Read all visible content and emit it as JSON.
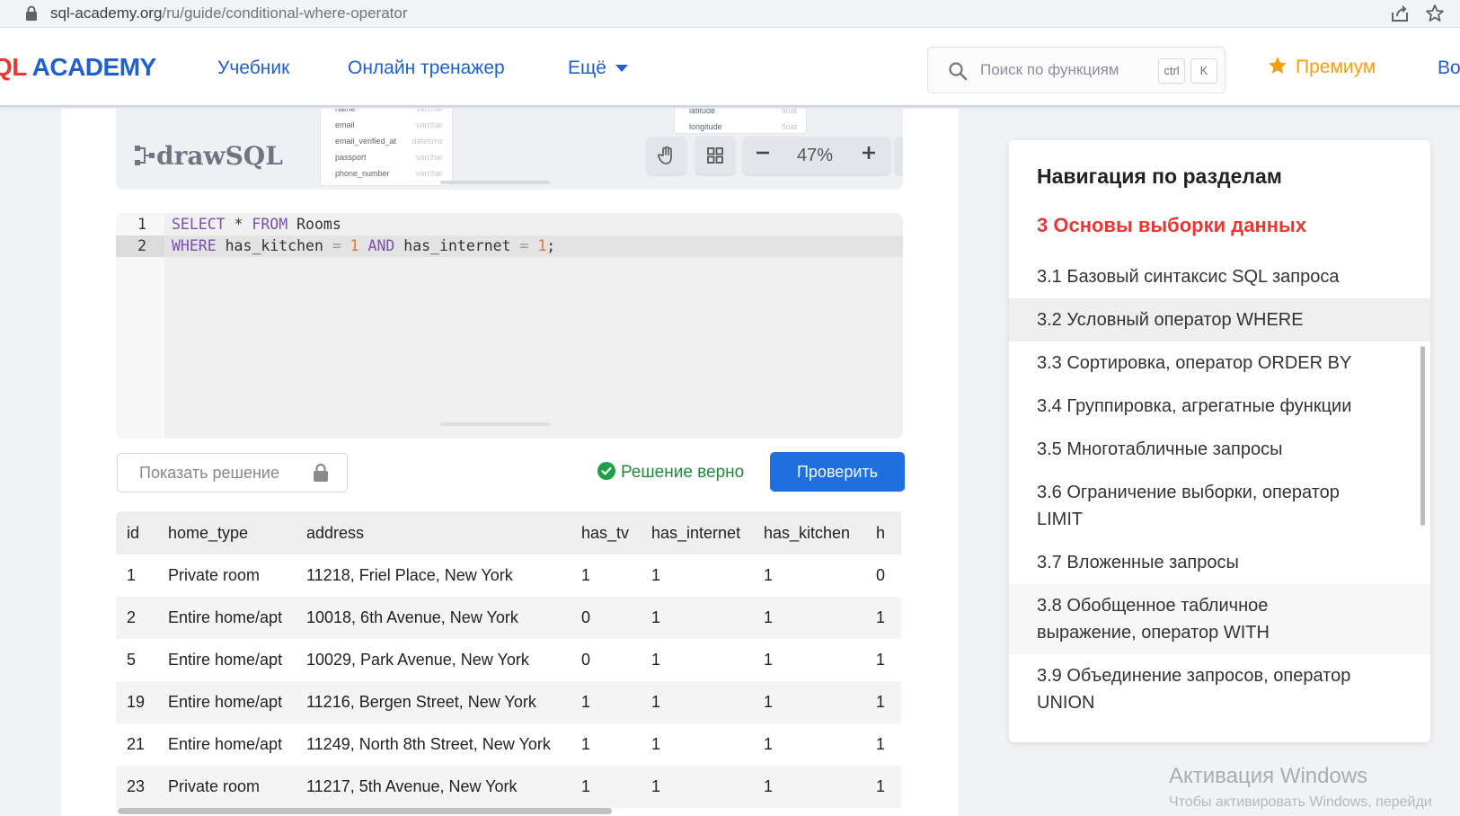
{
  "browser": {
    "url_host": "sql-academy.org",
    "url_path": "/ru/guide/conditional-where-operator"
  },
  "header": {
    "logo_red": "QL",
    "logo_blue": "ACADEMY",
    "nav": [
      "Учебник",
      "Онлайн тренажер"
    ],
    "more_label": "Ещё",
    "search_placeholder": "Поиск по функциям",
    "kbd_ctrl": "ctrl",
    "kbd_key": "K",
    "premium_label": "Премиум",
    "login_label": "Во"
  },
  "drawsql": {
    "logo_bold": "drawSQL",
    "table_left": [
      {
        "name": "name",
        "type": "varchar"
      },
      {
        "name": "email",
        "type": "varchar"
      },
      {
        "name": "email_verified_at",
        "type": "datetime"
      },
      {
        "name": "passport",
        "type": "varchar"
      },
      {
        "name": "phone_number",
        "type": "varchar"
      }
    ],
    "table_right": [
      {
        "name": "latitude",
        "type": "float"
      },
      {
        "name": "longitude",
        "type": "float"
      }
    ],
    "zoom": "47%"
  },
  "editor": {
    "line_numbers": [
      "1",
      "2"
    ],
    "line1": {
      "kw1": "SELECT",
      "star": " * ",
      "kw2": "FROM",
      "rest": " Rooms"
    },
    "line2": {
      "kw1": "WHERE",
      "col1": " has_kitchen ",
      "eq1": "=",
      "n1": " 1",
      "kw2": " AND",
      "col2": " has_internet ",
      "eq2": "=",
      "n2": " 1",
      "end": ";"
    }
  },
  "actions": {
    "show_solution": "Показать решение",
    "success_msg": "Решение верно",
    "check_btn": "Проверить"
  },
  "result": {
    "columns": [
      "id",
      "home_type",
      "address",
      "has_tv",
      "has_internet",
      "has_kitchen",
      "h"
    ],
    "rows": [
      [
        "1",
        "Private room",
        "11218, Friel Place, New York",
        "1",
        "1",
        "1",
        "0"
      ],
      [
        "2",
        "Entire home/apt",
        "10018, 6th Avenue, New York",
        "0",
        "1",
        "1",
        "1"
      ],
      [
        "5",
        "Entire home/apt",
        "10029, Park Avenue, New York",
        "0",
        "1",
        "1",
        "1"
      ],
      [
        "19",
        "Entire home/apt",
        "11216, Bergen Street, New York",
        "1",
        "1",
        "1",
        "1"
      ],
      [
        "21",
        "Entire home/apt",
        "11249, North 8th Street, New York",
        "1",
        "1",
        "1",
        "1"
      ],
      [
        "23",
        "Private room",
        "11217, 5th Avenue, New York",
        "1",
        "1",
        "1",
        "1"
      ]
    ]
  },
  "sidebar": {
    "title": "Навигация по разделам",
    "section": "3 Основы выборки данных",
    "items": [
      {
        "line1": "3.1 Базовый синтаксис SQL запроса",
        "line2": ""
      },
      {
        "line1": "3.2 Условный оператор WHERE",
        "line2": ""
      },
      {
        "line1": "3.3 Сортировка, оператор ORDER BY",
        "line2": ""
      },
      {
        "line1": "3.4 Группировка, агрегатные функции",
        "line2": ""
      },
      {
        "line1": "3.5 Многотабличные запросы",
        "line2": ""
      },
      {
        "line1": "3.6 Ограничение выборки, оператор",
        "line2": "LIMIT"
      },
      {
        "line1": "3.7 Вложенные запросы",
        "line2": ""
      },
      {
        "line1": "3.8 Обобщенное табличное",
        "line2": "выражение, оператор WITH"
      },
      {
        "line1": "3.9 Объединение запросов, оператор",
        "line2": "UNION"
      }
    ]
  },
  "watermark": {
    "title": "Активация Windows",
    "subtitle": "Чтобы активировать Windows, перейди"
  }
}
